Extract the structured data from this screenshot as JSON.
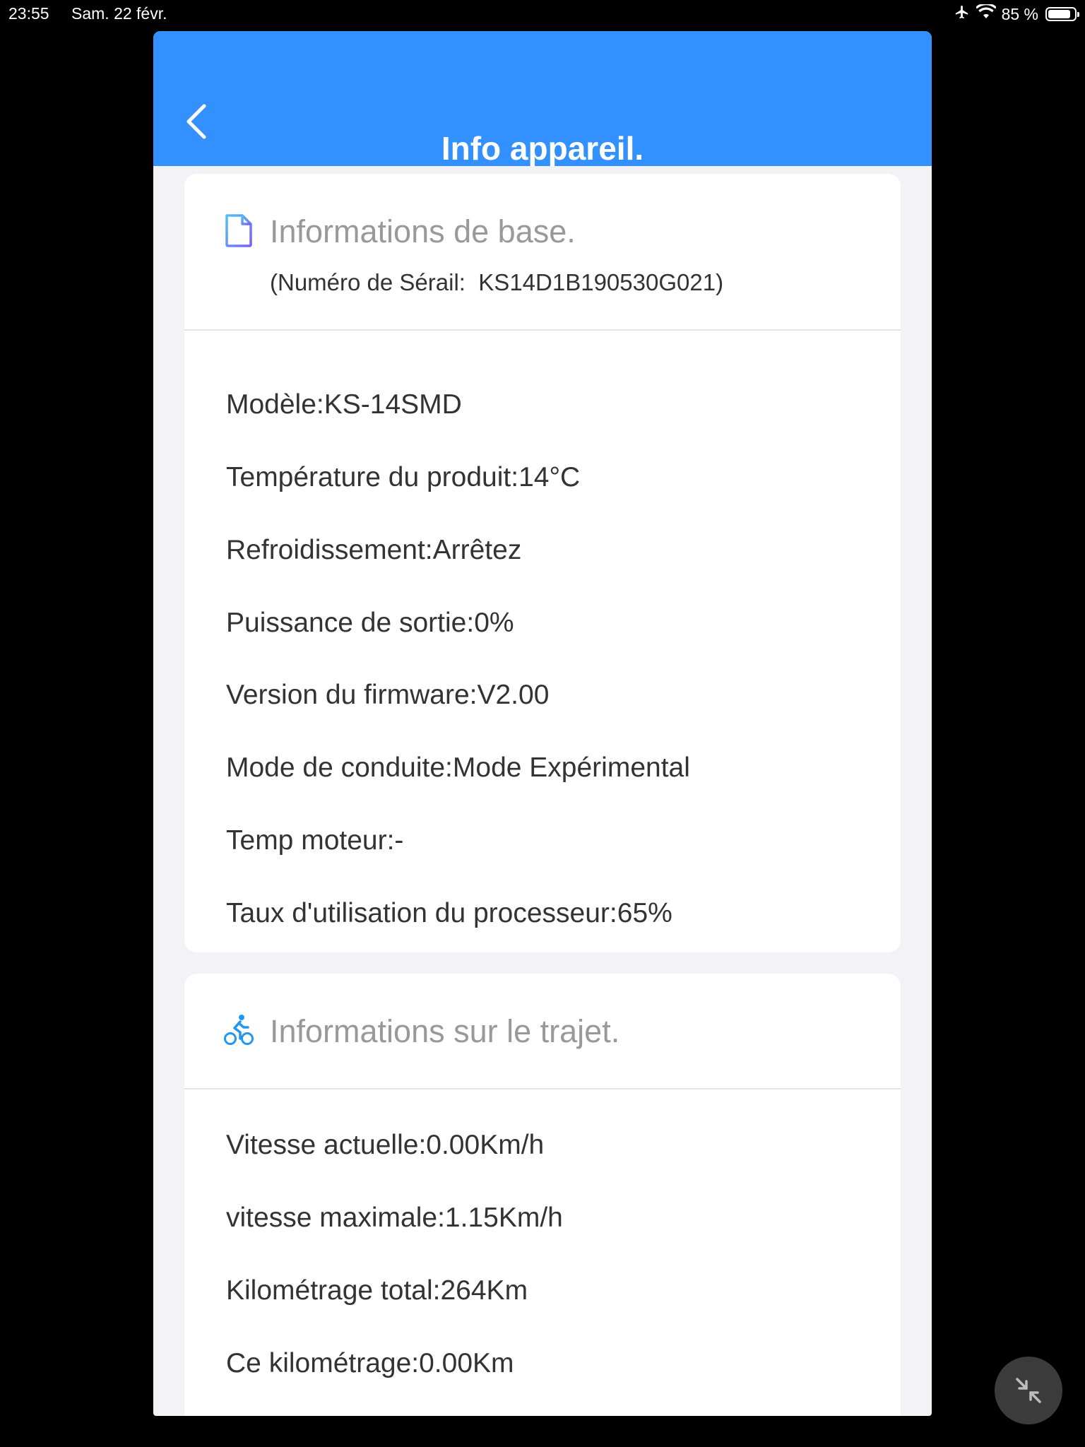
{
  "status_bar": {
    "time": "23:55",
    "date": "Sam. 22 févr.",
    "battery": "85 %",
    "battery_level_percent": 85,
    "icons": [
      "airplane-icon",
      "wifi-icon",
      "battery-icon"
    ]
  },
  "header": {
    "title": "Info appareil.",
    "background": "#3291ff",
    "back_icon": "chevron-left-icon"
  },
  "basic_info": {
    "title": "Informations de base.",
    "icon": "document-icon",
    "serial_label": "(Numéro de Sérail:",
    "serial_value": "KS14D1B190530G021)",
    "rows": [
      "Modèle:KS-14SMD",
      "Température du produit:14°C",
      "Refroidissement:Arrêtez",
      "Puissance de sortie:0%",
      "Version du firmware:V2.00",
      "Mode de conduite:Mode Expérimental",
      "Temp moteur:-",
      "Taux d'utilisation du processeur:65%"
    ]
  },
  "trip_info": {
    "title": "Informations sur le trajet.",
    "icon": "cyclist-icon",
    "rows": [
      "Vitesse actuelle:0.00Km/h",
      "vitesse maximale:1.15Km/h",
      "Kilométrage total:264Km",
      "Ce kilométrage:0.00Km"
    ]
  },
  "floating_button": {
    "icon": "collapse-arrows-icon"
  }
}
